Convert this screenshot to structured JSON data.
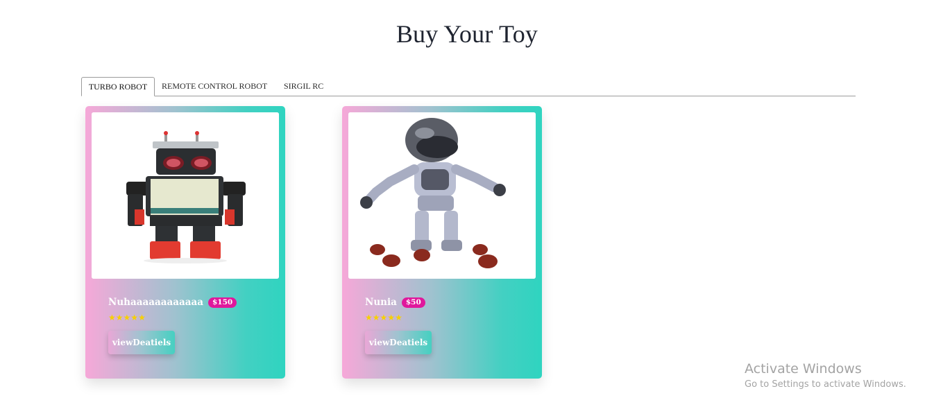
{
  "page": {
    "title": "Buy Your Toy"
  },
  "tabs": [
    {
      "label": "TURBO ROBOT",
      "active": true
    },
    {
      "label": "REMOTE CONTROL ROBOT",
      "active": false
    },
    {
      "label": "SIRGIL RC",
      "active": false
    }
  ],
  "products": [
    {
      "name": "Nuhaaaaaaaaaaaa",
      "price": "$150",
      "rating": 5,
      "button_label": "viewDeatiels",
      "image_icon": "retro-robot-image"
    },
    {
      "name": "Nunia",
      "price": "$50",
      "rating": 5,
      "button_label": "viewDeatiels",
      "image_icon": "humanoid-robot-image"
    }
  ],
  "colors": {
    "card_gradient_start": "#f6a8d8",
    "card_gradient_end": "#2fd4c0",
    "price_badge": "#e0189c",
    "star": "#f7d000"
  },
  "watermark": {
    "title": "Activate Windows",
    "subtitle": "Go to Settings to activate Windows."
  }
}
